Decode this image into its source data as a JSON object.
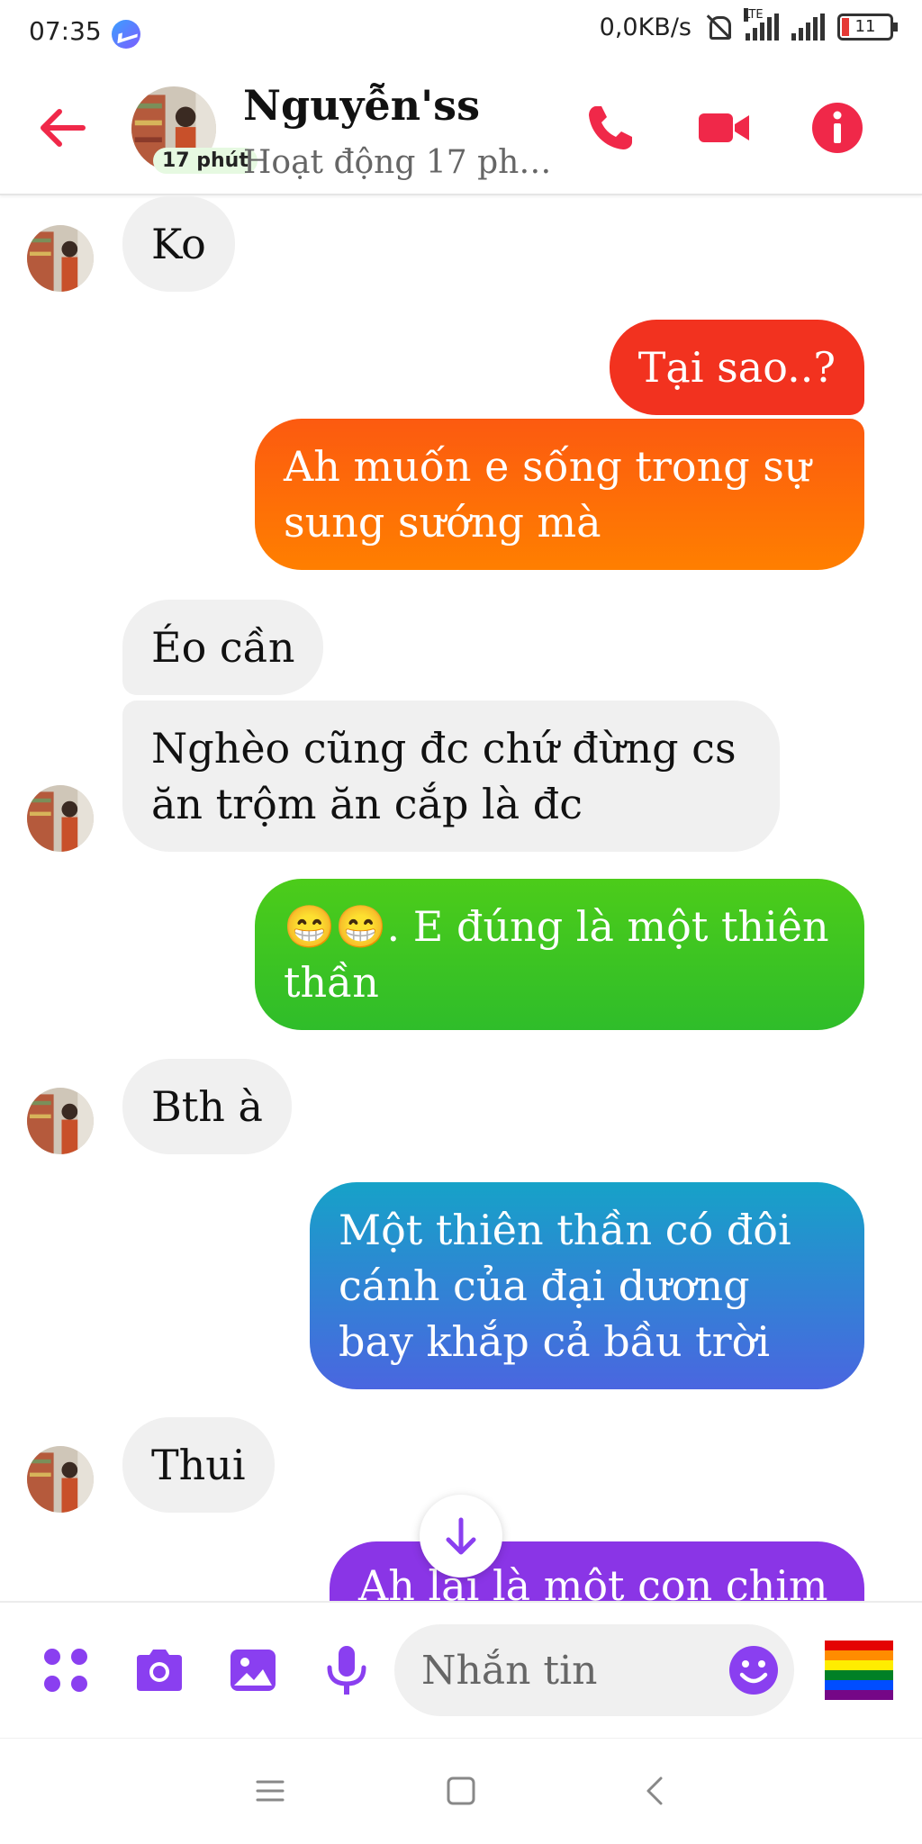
{
  "status_bar": {
    "time": "07:35",
    "speed": "0,0KB/s",
    "network": "LTE",
    "battery": "11"
  },
  "header": {
    "name": "Nguyễn'ss",
    "status": "Hoạt động 17 phút...",
    "avatar_badge": "17 phút",
    "accent_color": "#f02849"
  },
  "messages": [
    {
      "from": "them",
      "text": "Ko"
    },
    {
      "from": "me",
      "text": "Tại sao..?",
      "color": "#f2321f"
    },
    {
      "from": "me",
      "text": "Ah muốn e sống trong sự sung sướng mà",
      "color": "#ff6a0a"
    },
    {
      "from": "them",
      "text": "Éo cần"
    },
    {
      "from": "them",
      "text": "Nghèo cũng đc chứ đừng cs ăn trộm ăn cắp là đc"
    },
    {
      "from": "me",
      "text": "😁😁. E đúng là một thiên thần",
      "color": "#3cc21e"
    },
    {
      "from": "them",
      "text": "Bth à"
    },
    {
      "from": "me",
      "text": "Một  thiên thần có đôi cánh của đại dương bay khắp  cả bầu  trời",
      "color": "#2f8fe0"
    },
    {
      "from": "them",
      "text": "Thui"
    },
    {
      "from": "me",
      "text": "Ah lại là một con chim",
      "color": "#8a35e6"
    }
  ],
  "composer": {
    "placeholder": "Nhắn tin",
    "accent_color": "#8a3ff0",
    "quick_reaction": "rainbow-flag"
  }
}
